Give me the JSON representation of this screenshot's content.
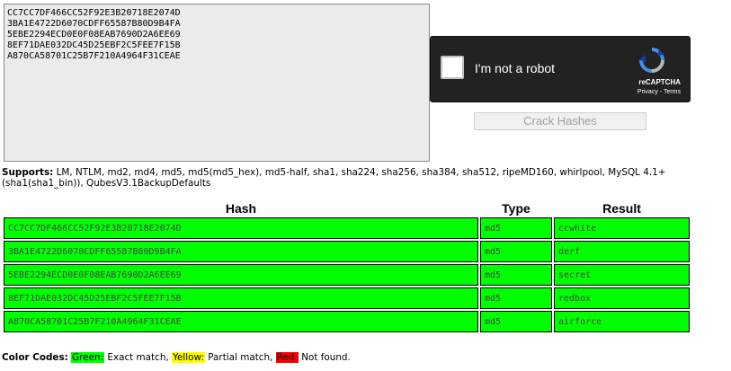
{
  "input": {
    "hashes_text": "CC7CC7DF466CC52F92E3B20718E2074D\n3BA1E4722D6070CDFF65587B80D9B4FA\n5EBE2294ECD0E0F08EAB7690D2A6EE69\n8EF71DAE032DC45D25EBF2C5FEE7F15B\nA870CA58701C25B7F210A4964F31CEAE"
  },
  "captcha": {
    "label": "I'm not a robot",
    "brand": "reCAPTCHA",
    "privacy": "Privacy",
    "separator": " - ",
    "terms": "Terms"
  },
  "crack_button_label": "Crack Hashes",
  "supports": {
    "label": "Supports:",
    "text": " LM, NTLM, md2, md4, md5, md5(md5_hex), md5-half, sha1, sha224, sha256, sha384, sha512, ripeMD160, whirlpool, MySQL 4.1+ (sha1(sha1_bin)), QubesV3.1BackupDefaults"
  },
  "table": {
    "headers": [
      "Hash",
      "Type",
      "Result"
    ],
    "rows": [
      {
        "hash": "CC7CC7DF466CC52F92E3B20718E2074D",
        "type": "md5",
        "result": "ccwhite"
      },
      {
        "hash": "3BA1E4722D6070CDFF65587B80D9B4FA",
        "type": "md5",
        "result": "derf"
      },
      {
        "hash": "5EBE2294ECD0E0F08EAB7690D2A6EE69",
        "type": "md5",
        "result": "secret"
      },
      {
        "hash": "8EF71DAE032DC45D25EBF2C5FEE7F15B",
        "type": "md5",
        "result": "redbox"
      },
      {
        "hash": "A870CA58701C25B7F210A4964F31CEAE",
        "type": "md5",
        "result": "airforce"
      }
    ]
  },
  "legend": {
    "label": "Color Codes:",
    "green": "Green:",
    "green_text": " Exact match, ",
    "yellow": "Yellow:",
    "yellow_text": " Partial match, ",
    "red": "Red:",
    "red_text": " Not found."
  },
  "colors": {
    "exact_match": "#00ff00",
    "partial_match": "#ffff00",
    "not_found": "#ff0000",
    "captcha_bg": "#222222"
  }
}
